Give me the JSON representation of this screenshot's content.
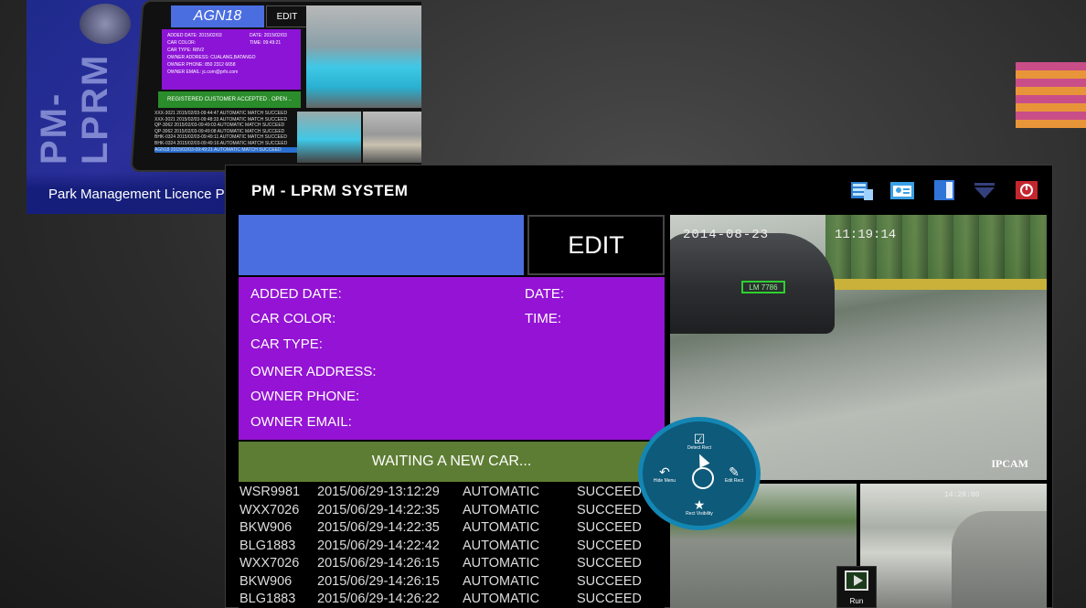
{
  "thumbnail": {
    "brand": "PM-LPRM",
    "caption": "Park Management Licence P",
    "plate": "AGN18",
    "edit_label": "EDIT",
    "info_lines": [
      "ADDED DATE: 2015/02/03",
      "CAR COLOR:",
      "CAR TYPE: R8V2",
      "OWNER ADDRESS: CUALANG,BATANGO",
      "OWNER PHONE: 850 2312 6658",
      "OWNER EMAIL: jc.com@prfo.com"
    ],
    "info_right": [
      "DATE: 2015/02/03",
      "TIME: 09:49:21"
    ],
    "status": "REGISTERED CUSTOMER ACCEPTED . OPEN ..",
    "log": [
      "XXX-3021   2015/02/03-09:44:47   AUTOMATIC   MATCH SUCCEED",
      "XXX-3021   2015/02/03-09:48:33   AUTOMATIC   MATCH SUCCEED",
      "QP-3062    2015/02/03-09:49:03   AUTOMATIC   MATCH SUCCEED",
      "QP-3062    2015/02/03-09:49:08   AUTOMATIC   MATCH SUCCEED",
      "BHK-0324   2015/02/03-09:49:11   AUTOMATIC   MATCH SUCCEED",
      "BHK-0324   2015/02/03-09:49:16   AUTOMATIC   MATCH SUCCEED",
      "AGN18      2015/02/03-09:49:21   AUTOMATIC   MATCH SUCCEED"
    ]
  },
  "app": {
    "title": "PM - LPRM SYSTEM",
    "icons": [
      "database-icon",
      "id-card-icon",
      "panel-icon",
      "dropdown-icon",
      "power-icon"
    ],
    "edit_label": "EDIT",
    "plate_value": "",
    "fields": {
      "added_date": "ADDED DATE:",
      "car_color": "CAR COLOR:",
      "car_type": "CAR TYPE:",
      "owner_address": "OWNER ADDRESS:",
      "owner_phone": "OWNER PHONE:",
      "owner_email": "OWNER EMAIL:",
      "date": "DATE:",
      "time": "TIME:"
    },
    "status": "WAITING A NEW CAR...",
    "log": [
      {
        "plate": "WSR9981",
        "datetime": "2015/06/29-13:12:29",
        "mode": "AUTOMATIC",
        "result": "SUCCEED"
      },
      {
        "plate": "WXX7026",
        "datetime": "2015/06/29-14:22:35",
        "mode": "AUTOMATIC",
        "result": "SUCCEED"
      },
      {
        "plate": "BKW906",
        "datetime": "2015/06/29-14:22:35",
        "mode": "AUTOMATIC",
        "result": "SUCCEED"
      },
      {
        "plate": "BLG1883",
        "datetime": "2015/06/29-14:22:42",
        "mode": "AUTOMATIC",
        "result": "SUCCEED"
      },
      {
        "plate": "WXX7026",
        "datetime": "2015/06/29-14:26:15",
        "mode": "AUTOMATIC",
        "result": "SUCCEED"
      },
      {
        "plate": "BKW906",
        "datetime": "2015/06/29-14:26:15",
        "mode": "AUTOMATIC",
        "result": "SUCCEED"
      },
      {
        "plate": "BLG1883",
        "datetime": "2015/06/29-14:26:22",
        "mode": "AUTOMATIC",
        "result": "SUCCEED"
      }
    ],
    "camera": {
      "date": "2014-08-23",
      "time": "11:19:14",
      "label": "IPCAM",
      "detected_plate": "LM 7786",
      "small_timestamp": "14:28:00"
    },
    "radial_menu": {
      "top": "Detect Rect",
      "left": "Hide Menu",
      "right": "Edit Rect",
      "bottom": "Rect Visibility"
    },
    "run_label": "Run"
  },
  "colors": {
    "plate_blue": "#4a6ee0",
    "info_purple": "#9413d4",
    "status_green": "#5e7d34",
    "menu_blue": "#1486b3"
  }
}
